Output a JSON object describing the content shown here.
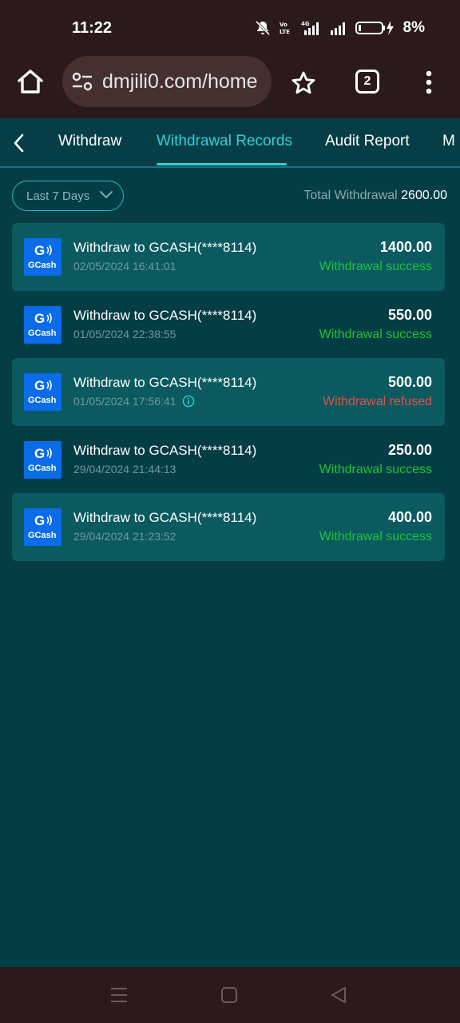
{
  "status_bar": {
    "time": "11:22",
    "battery": "8%",
    "network": "4G"
  },
  "browser": {
    "url": "dmjili0.com/home",
    "tab_count": "2"
  },
  "tabs": [
    {
      "label": "Withdraw",
      "active": false
    },
    {
      "label": "Withdrawal Records",
      "active": true
    },
    {
      "label": "Audit Report",
      "active": false
    },
    {
      "label": "M",
      "active": false
    }
  ],
  "filter": {
    "label": "Last 7 Days"
  },
  "summary": {
    "label": "Total Withdrawal",
    "amount": "2600.00"
  },
  "records": [
    {
      "title": "Withdraw to GCASH(****8114)",
      "date": "02/05/2024 16:41:01",
      "amount": "1400.00",
      "status": "Withdrawal success",
      "success": true,
      "info": false
    },
    {
      "title": "Withdraw to GCASH(****8114)",
      "date": "01/05/2024 22:38:55",
      "amount": "550.00",
      "status": "Withdrawal success",
      "success": true,
      "info": false
    },
    {
      "title": "Withdraw to GCASH(****8114)",
      "date": "01/05/2024 17:56:41",
      "amount": "500.00",
      "status": "Withdrawal refused",
      "success": false,
      "info": true
    },
    {
      "title": "Withdraw to GCASH(****8114)",
      "date": "29/04/2024 21:44:13",
      "amount": "250.00",
      "status": "Withdrawal success",
      "success": true,
      "info": false
    },
    {
      "title": "Withdraw to GCASH(****8114)",
      "date": "29/04/2024 21:23:52",
      "amount": "400.00",
      "status": "Withdrawal success",
      "success": true,
      "info": false
    }
  ],
  "logo_text": {
    "mark": "G",
    "brand": "GCash"
  },
  "colors": {
    "success": "#1fc43a",
    "refused": "#e0524a",
    "accent": "#2fd0d8",
    "background": "#053d45",
    "row_shade": "#0a5a60",
    "gcash_blue": "#0b6cea"
  },
  "icons": {
    "home": "home-icon",
    "tune": "site-settings-icon",
    "star": "bookmark-star-icon",
    "more": "more-vertical-icon",
    "back": "chevron-left-icon",
    "dropdown": "chevron-down-icon",
    "info": "info-icon"
  }
}
